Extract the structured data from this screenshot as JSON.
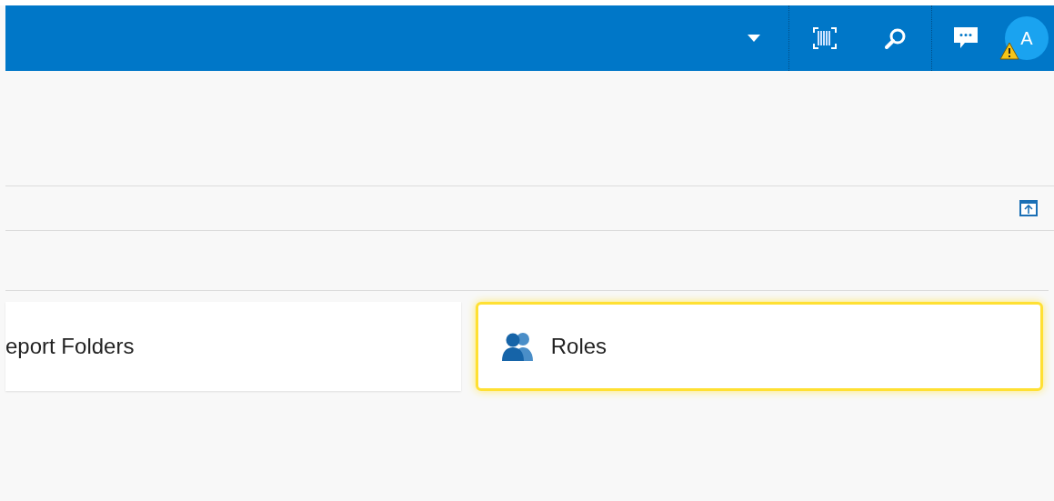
{
  "header": {
    "avatar": {
      "initial": "A",
      "warning": true
    }
  },
  "cards": [
    {
      "label": "eport Folders",
      "selected": false
    },
    {
      "label": "Roles",
      "selected": true
    }
  ]
}
